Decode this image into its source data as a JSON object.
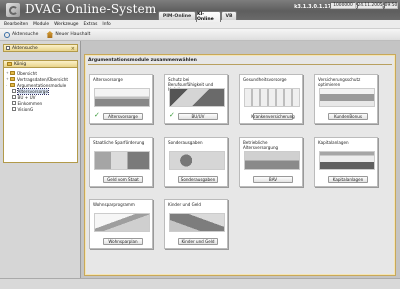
{
  "window": {
    "title": "DVAG Online-System",
    "status_line": "k3.1.3.0.1.17 local client : null null"
  },
  "module_tabs": [
    {
      "label": "PIM-Online",
      "active": false
    },
    {
      "label": "KI-Online",
      "active": true
    },
    {
      "label": "VB",
      "active": false
    }
  ],
  "menu": [
    "Bearbeiten",
    "Module",
    "Werkzeuge",
    "Extras",
    "Info"
  ],
  "toolbar": {
    "search_label": "Aktensuche",
    "household_label": "Neuer Haushalt"
  },
  "left_panel": {
    "search_title": "Aktensuche",
    "close_symbol": "×",
    "tree_title": "König",
    "tree": [
      {
        "label": "Übersicht",
        "level": 1,
        "type": "folder",
        "expander": "+"
      },
      {
        "label": "Vertragsdaten/Übersicht",
        "level": 1,
        "type": "folder",
        "expander": "+"
      },
      {
        "label": "Argumentationsmodule",
        "level": 1,
        "type": "folder",
        "expander": "-"
      },
      {
        "label": "Altersvorsorge",
        "level": 2,
        "type": "doc",
        "selected": true
      },
      {
        "label": "BU + UV",
        "level": 2,
        "type": "doc"
      },
      {
        "label": "Einkommen",
        "level": 2,
        "type": "doc"
      },
      {
        "label": "VisionG",
        "level": 2,
        "type": "doc"
      }
    ]
  },
  "main": {
    "header": "Argumentationsmodule zusammenwählen",
    "cards": [
      {
        "title": "Altersvorsorge",
        "button": "Altersvorsorge",
        "checked": true,
        "img": "a"
      },
      {
        "title": "Schutz bei Berufsunfähigkeit und Unfall",
        "button": "BU/UV",
        "checked": true,
        "img": "b"
      },
      {
        "title": "Gesundheitsvorsorge",
        "button": "Krankenversicherung",
        "checked": false,
        "img": "c"
      },
      {
        "title": "Versicherungsschutz optimieren",
        "button": "KundenBonus",
        "checked": false,
        "img": "d"
      },
      {
        "title": "Staatliche Sparförderung",
        "button": "Geld vom Staat",
        "checked": false,
        "img": "e"
      },
      {
        "title": "Sonderausgaben",
        "button": "Sonderausgaben",
        "checked": false,
        "img": "f"
      },
      {
        "title": "Betriebliche Altersversorgung",
        "button": "BAV",
        "checked": false,
        "img": "g"
      },
      {
        "title": "Kapitalanlagen",
        "button": "Kapitalanlagen",
        "checked": false,
        "img": "h"
      },
      {
        "title": "Wohnsparprogramm",
        "button": "Wohnsparplan",
        "checked": false,
        "img": "i"
      },
      {
        "title": "Kinder und Geld",
        "button": "Kinder und Geld",
        "checked": false,
        "img": "j"
      }
    ]
  },
  "statusbar": {
    "id": "1000000",
    "date": "24.11.2005",
    "time": "09:50"
  }
}
